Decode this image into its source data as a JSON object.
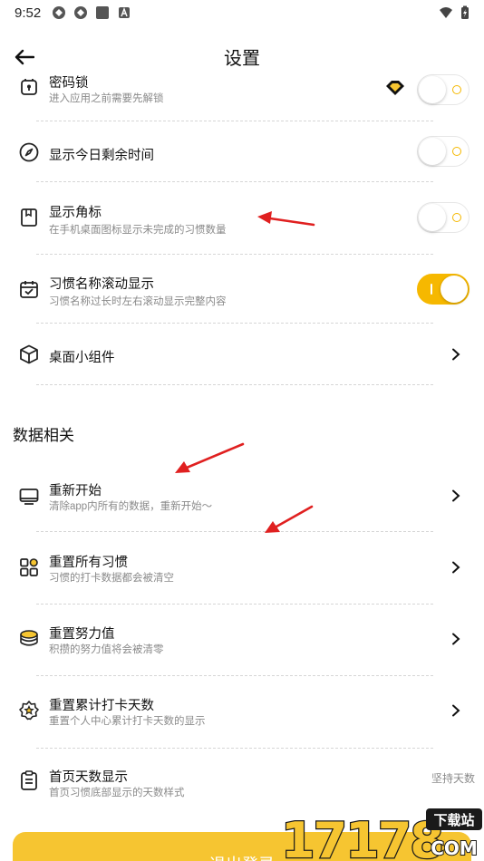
{
  "status_bar": {
    "time": "9:52"
  },
  "header": {
    "title": "设置"
  },
  "rows": [
    {
      "title": "密码锁",
      "subtitle": "进入应用之前需要先解锁",
      "toggle": false
    },
    {
      "title": "显示今日剩余时间",
      "toggle": false
    },
    {
      "title": "显示角标",
      "subtitle": "在手机桌面图标显示未完成的习惯数量",
      "toggle": false
    },
    {
      "title": "习惯名称滚动显示",
      "subtitle": "习惯名称过长时左右滚动显示完整内容",
      "toggle": true
    },
    {
      "title": "桌面小组件"
    }
  ],
  "section": {
    "title": "数据相关"
  },
  "data_rows": [
    {
      "title": "重新开始",
      "subtitle": "清除app内所有的数据，重新开始～"
    },
    {
      "title": "重置所有习惯",
      "subtitle": "习惯的打卡数据都会被清空"
    },
    {
      "title": "重置努力值",
      "subtitle": "积攒的努力值将会被清零"
    },
    {
      "title": "重置累计打卡天数",
      "subtitle": "重置个人中心累计打卡天数的显示"
    },
    {
      "title": "首页天数显示",
      "subtitle": "首页习惯底部显示的天数样式",
      "value": "坚持天数"
    }
  ],
  "footer": {
    "logout_label": "退出登录"
  },
  "watermark": {
    "text": "17178",
    "badge": "下载站",
    "domain": "COM"
  },
  "colors": {
    "accent": "#f6b800",
    "annotation": "#e02020"
  }
}
